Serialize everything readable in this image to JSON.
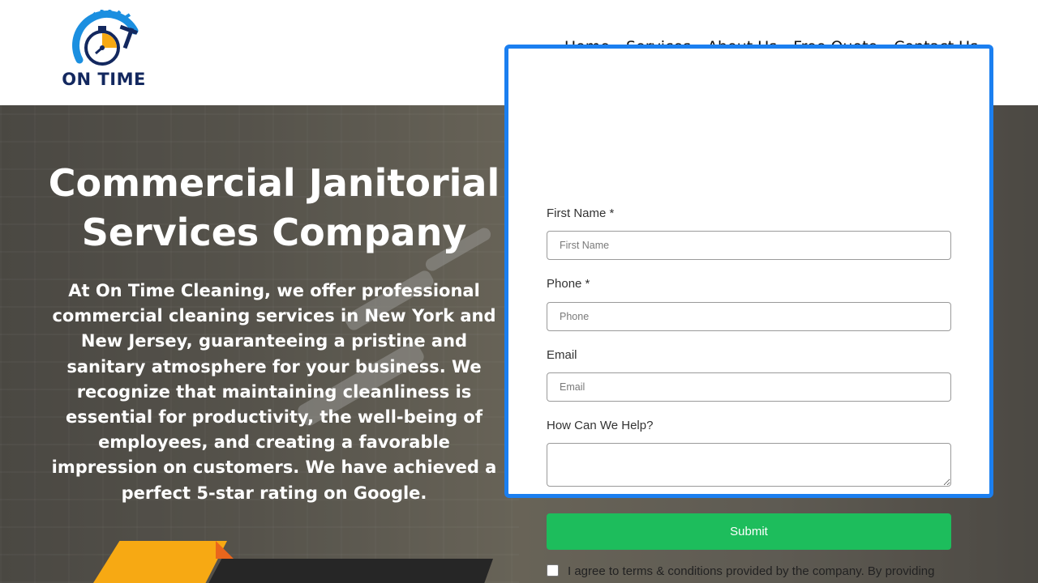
{
  "brand": {
    "name": "ON TIME",
    "colors": {
      "navy": "#13285f",
      "blue": "#1b8fe0",
      "orange": "#f7a913",
      "accent_border": "#1b7ff0",
      "submit_green": "#1dbd5c"
    },
    "logo_icon": "stopwatch-squeegee-icon"
  },
  "nav": {
    "items": [
      {
        "label": "Home"
      },
      {
        "label": "Services"
      },
      {
        "label": "About Us"
      },
      {
        "label": "Free Quote"
      },
      {
        "label": "Contact Us"
      }
    ]
  },
  "hero": {
    "title_line1": "Commercial Janitorial",
    "title_line2": "Services Company",
    "description": "At On Time Cleaning, we offer professional commercial cleaning services in New York and New Jersey, guaranteeing a pristine and sanitary atmosphere for your business. We recognize that maintaining cleanliness is essential for productivity, the well-being of employees, and creating a favorable impression on customers. We have achieved a perfect 5-star rating on Google."
  },
  "form": {
    "first_name": {
      "label": "First Name *",
      "placeholder": "First Name",
      "value": ""
    },
    "phone": {
      "label": "Phone *",
      "placeholder": "Phone",
      "value": ""
    },
    "email": {
      "label": "Email",
      "placeholder": "Email",
      "value": ""
    },
    "help": {
      "label": "How Can We Help?",
      "value": ""
    },
    "submit_label": "Submit",
    "terms": {
      "checked": false,
      "text": "I agree to terms & conditions provided by the company. By providing"
    }
  }
}
